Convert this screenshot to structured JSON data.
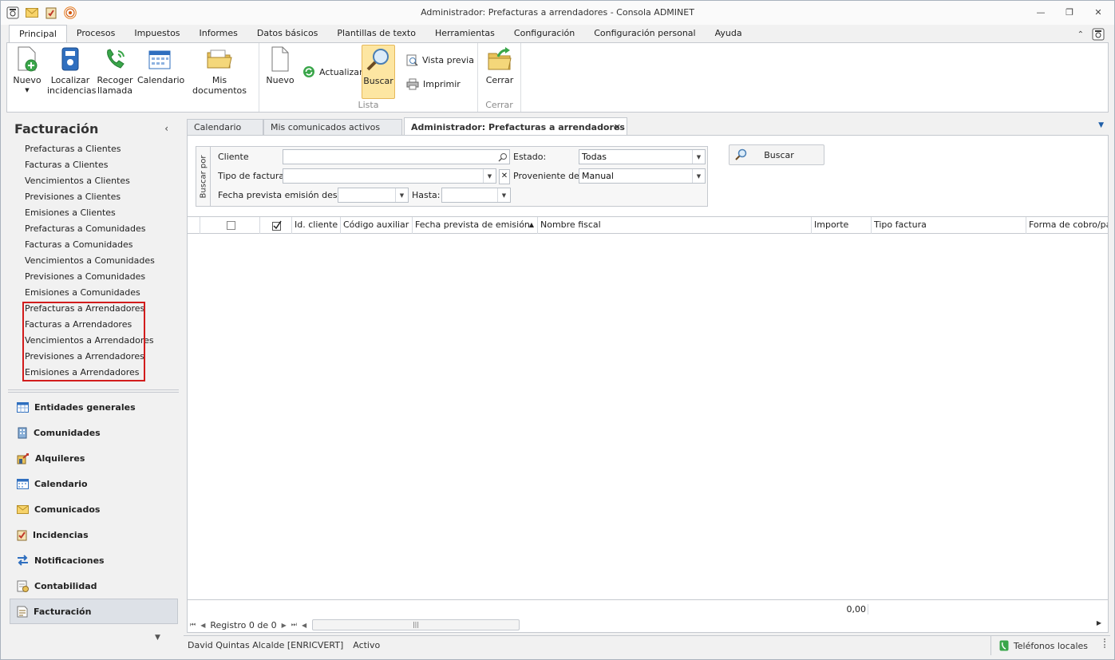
{
  "window": {
    "title": "Administrador: Prefacturas a arrendadores - Consola ADMINET",
    "controls": [
      "minimize-icon",
      "restore-icon",
      "close-icon"
    ]
  },
  "ribbon": {
    "tabs": [
      "Principal",
      "Procesos",
      "Impuestos",
      "Informes",
      "Datos básicos",
      "Plantillas de texto",
      "Herramientas",
      "Configuración",
      "Configuración personal",
      "Ayuda"
    ],
    "active_tab": "Principal",
    "group1": {
      "nuevo": "Nuevo",
      "localizar": [
        "Localizar",
        "incidencias"
      ],
      "recoger": [
        "Recoger",
        "llamada"
      ],
      "calendario": "Calendario",
      "mis_documentos": "Mis documentos"
    },
    "lista": {
      "nuevo": "Nuevo",
      "actualizar": "Actualizar",
      "buscar": "Buscar",
      "vista_previa": "Vista previa",
      "imprimir": "Imprimir",
      "label": "Lista"
    },
    "cerrar": {
      "cerrar": "Cerrar",
      "label": "Cerrar"
    }
  },
  "nav": {
    "title": "Facturación",
    "links": [
      "Prefacturas a Clientes",
      "Facturas a Clientes",
      "Vencimientos a Clientes",
      "Previsiones a Clientes",
      "Emisiones a Clientes",
      "Prefacturas a Comunidades",
      "Facturas a Comunidades",
      "Vencimientos a Comunidades",
      "Previsiones a Comunidades",
      "Emisiones a Comunidades",
      "Prefacturas a Arrendadores",
      "Facturas a Arrendadores",
      "Vencimientos a Arrendadores",
      "Previsiones a Arrendadores",
      "Emisiones a Arrendadores"
    ],
    "sections": [
      "Entidades generales",
      "Comunidades",
      "Alquileres",
      "Calendario",
      "Comunicados",
      "Incidencias",
      "Notificaciones",
      "Contabilidad",
      "Facturación"
    ],
    "active_section": "Facturación"
  },
  "doc_tabs": {
    "tabs": [
      "Calendario",
      "Mis comunicados activos",
      "Administrador: Prefacturas a arrendadores"
    ],
    "active": "Administrador: Prefacturas a arrendadores"
  },
  "filter": {
    "side_label": "Buscar por",
    "cliente_label": "Cliente",
    "cliente_value": "",
    "tipo_label": "Tipo de factura:",
    "tipo_value": "",
    "fecha_desde_label": "Fecha prevista emisión desde:",
    "fecha_desde_value": "",
    "hasta_label": "Hasta:",
    "hasta_value": "",
    "estado_label": "Estado:",
    "estado_value": "Todas",
    "proveniente_label": "Proveniente de:",
    "proveniente_value": "Manual",
    "buscar_button": "Buscar"
  },
  "grid": {
    "columns": [
      "Id. cliente",
      "Código auxiliar",
      "Fecha prevista de emisión",
      "Nombre fiscal",
      "Importe",
      "Tipo factura",
      "Forma de cobro/pag"
    ],
    "sorted_column": "Fecha prevista de emisión",
    "rows": [],
    "total": "0,00",
    "pager_text": "Registro 0 de 0"
  },
  "status": {
    "user": "David Quintas Alcalde [ENRICVERT]",
    "state": "Activo",
    "phones": "Teléfonos locales"
  }
}
